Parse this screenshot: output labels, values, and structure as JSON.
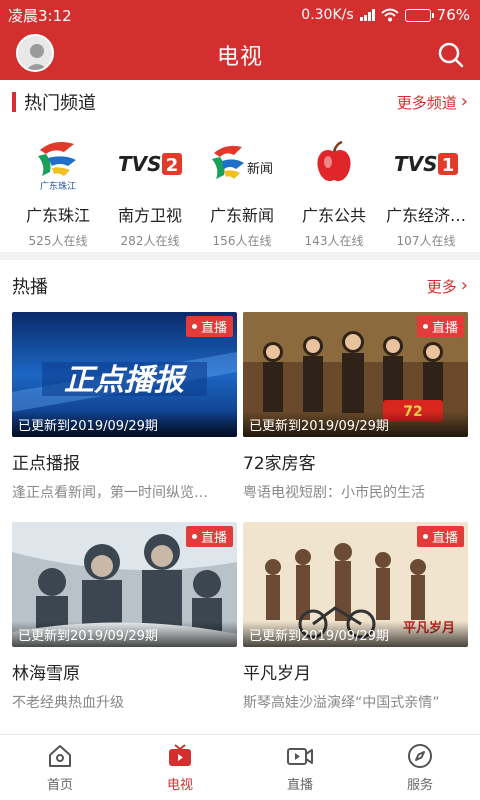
{
  "status": {
    "time": "凌晨3:12",
    "speed": "0.30K/s",
    "battery": "76%",
    "battery_level": 0.76
  },
  "header": {
    "title": "电视"
  },
  "hot_channels": {
    "title": "热门频道",
    "more": "更多频道",
    "items": [
      {
        "name": "广东珠江",
        "count": "525人在线",
        "logo": "gdtv-zhujiang-logo",
        "logo_text": "广东珠江"
      },
      {
        "name": "南方卫视",
        "count": "282人在线",
        "logo": "tvs2-logo",
        "logo_text": "TVS2"
      },
      {
        "name": "广东新闻",
        "count": "156人在线",
        "logo": "gdtv-news-logo",
        "logo_text": "新闻"
      },
      {
        "name": "广东公共",
        "count": "143人在线",
        "logo": "apple-logo"
      },
      {
        "name": "广东经济…",
        "count": "107人在线",
        "logo": "tvs1-logo",
        "logo_text": "TVS1"
      }
    ]
  },
  "hot_play": {
    "title": "热播",
    "more": "更多",
    "items": [
      {
        "title": "正点播报",
        "desc": "逢正点看新闻，第一时间纵览…",
        "badge": "直播",
        "updated": "已更新到2019/09/29期",
        "poster_text": "正点播报"
      },
      {
        "title": "72家房客",
        "desc": "粤语电视短剧：小市民的生活",
        "badge": "直播",
        "updated": "已更新到2019/09/29期"
      },
      {
        "title": "林海雪原",
        "desc": "不老经典热血升级",
        "badge": "直播",
        "updated": "已更新到2019/09/29期"
      },
      {
        "title": "平凡岁月",
        "desc": "斯琴高娃沙溢演绎“中国式亲情”",
        "badge": "直播",
        "updated": "已更新到2019/09/29期"
      }
    ]
  },
  "nav": {
    "items": [
      {
        "label": "首页",
        "icon": "home-icon",
        "active": false
      },
      {
        "label": "电视",
        "icon": "tv-icon",
        "active": true
      },
      {
        "label": "直播",
        "icon": "live-video-icon",
        "active": false
      },
      {
        "label": "服务",
        "icon": "compass-icon",
        "active": false
      }
    ]
  },
  "colors": {
    "brand": "#d42f2f",
    "live_badge": "#e33a3a",
    "muted": "#888888"
  }
}
